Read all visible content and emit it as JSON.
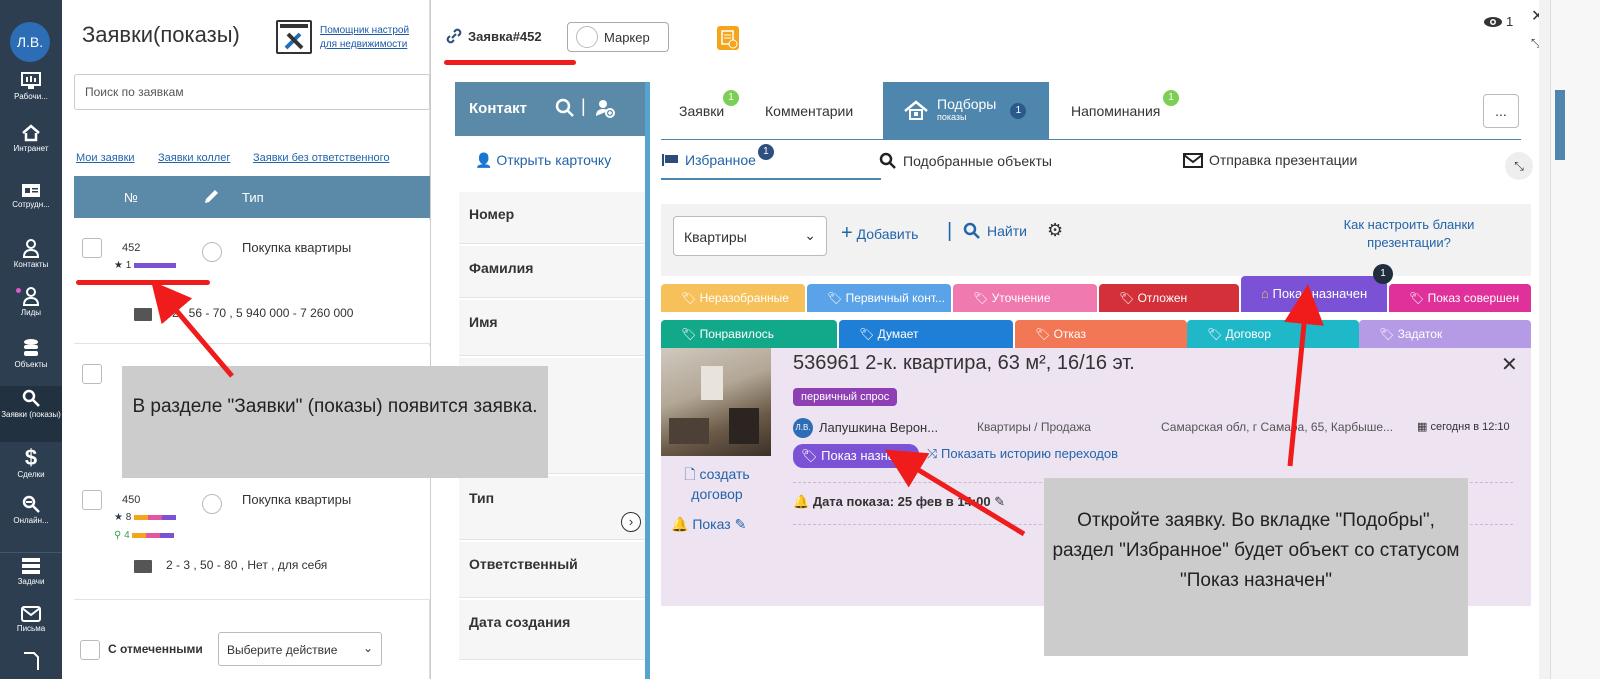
{
  "leftnav": {
    "avatar": "Л.В.",
    "items": [
      {
        "label": "Рабочи...",
        "icon": "dashboard-icon"
      },
      {
        "label": "Интранет",
        "icon": "home-icon"
      },
      {
        "label": "Сотрудн...",
        "icon": "id-card-icon"
      },
      {
        "label": "Контакты",
        "icon": "person-icon"
      },
      {
        "label": "Лиды",
        "icon": "person-icon"
      },
      {
        "label": "Объекты",
        "icon": "database-icon"
      },
      {
        "label": "Заявки (показы)",
        "icon": "search-icon"
      },
      {
        "label": "Сделки",
        "icon": "dollar-icon"
      },
      {
        "label": "Онлайн...",
        "icon": "online-icon"
      },
      {
        "label": "Задачи",
        "icon": "tasks-icon"
      },
      {
        "label": "Письма",
        "icon": "mail-icon"
      }
    ]
  },
  "list": {
    "title": "Заявки(показы)",
    "helper_link": "Помощник настрой... для недвижимости",
    "helper_line1": "Помощник настрой",
    "helper_line2": "для недвижимости",
    "search_placeholder": "Поиск по заявкам",
    "filters": [
      "Мои заявки",
      "Заявки коллег",
      "Заявки без ответственного"
    ],
    "columns": {
      "num": "№",
      "type": "Тип"
    },
    "rows": [
      {
        "num": "452",
        "stars": "1",
        "type": "Покупка квартиры",
        "details": "2 , 56 - 70 , 5 940 000 - 7 260 000"
      },
      {
        "num": "450",
        "stars": "8",
        "searches": "4",
        "type": "Покупка квартиры",
        "details": "2 - 3 , 50 - 80 , Нет , для себя"
      }
    ],
    "bulk_label": "С отмеченными",
    "bulk_select": "Выберите действие"
  },
  "modal": {
    "title": "Заявка#452",
    "marker": "Маркер",
    "views": "1",
    "contact": {
      "header": "Контакт",
      "open_card": "Открыть карточку",
      "fields": [
        "Номер",
        "Фамилия",
        "Имя",
        "Тип",
        "Ответственный",
        "Дата создания"
      ]
    },
    "tabs": [
      {
        "label": "Заявки",
        "badge": "1"
      },
      {
        "label": "Комментарии"
      },
      {
        "label": "Подборы",
        "sub": "показы",
        "badge": "1"
      },
      {
        "label": "Напоминания",
        "badge": "1"
      }
    ],
    "more": "...",
    "subtabs": [
      {
        "label": "Избранное",
        "badge": "1"
      },
      {
        "label": "Подобранные объекты"
      },
      {
        "label": "Отправка презентации"
      }
    ],
    "toolbar": {
      "select": "Квартиры",
      "add": "Добавить",
      "find": "Найти",
      "help": "Как настроить бланки презентации?"
    },
    "statuses_row1": [
      {
        "label": "Неразобранные",
        "color": "#f6c15a"
      },
      {
        "label": "Первичный конт...",
        "color": "#5aa3e8"
      },
      {
        "label": "Уточнение",
        "color": "#f07ab0"
      },
      {
        "label": "Отложен",
        "color": "#d4303a"
      },
      {
        "label": "Показ назначен",
        "color": "#7b52d6",
        "badge": "1"
      },
      {
        "label": "Показ совершен",
        "color": "#e0309a"
      }
    ],
    "statuses_row2": [
      {
        "label": "Понравилось",
        "color": "#12a88a"
      },
      {
        "label": "Думает",
        "color": "#1f7fd6"
      },
      {
        "label": "Отказ",
        "color": "#f27755"
      },
      {
        "label": "Договор",
        "color": "#1fb8c9"
      },
      {
        "label": "Задаток",
        "color": "#b59be6"
      }
    ],
    "object": {
      "title": "536961 2-к. квартира, 63 м², 16/16 эт.",
      "tag": "первичный спрос",
      "agent_avatar": "Л.В.",
      "agent": "Лапушкина Верон...",
      "category": "Квартиры / Продажа",
      "address": "Самарская обл, г Самара, 65, Карбыше...",
      "date": "сегодня в 12:10",
      "status": "Показ назначен",
      "status_shown": "Показ назнач",
      "history": "Показать историю переходов",
      "create_contract": "создать договор",
      "show_label": "Показ",
      "show_date": "Дата показа: 25 фев в 14:00"
    }
  },
  "callouts": {
    "left": "В разделе \"Заявки\"  (показы) появится заявка.",
    "right": "Откройте заявку. Во вкладке \"Подобры\", раздел \"Избранное\" будет объект со статусом \"Показ назначен\""
  }
}
